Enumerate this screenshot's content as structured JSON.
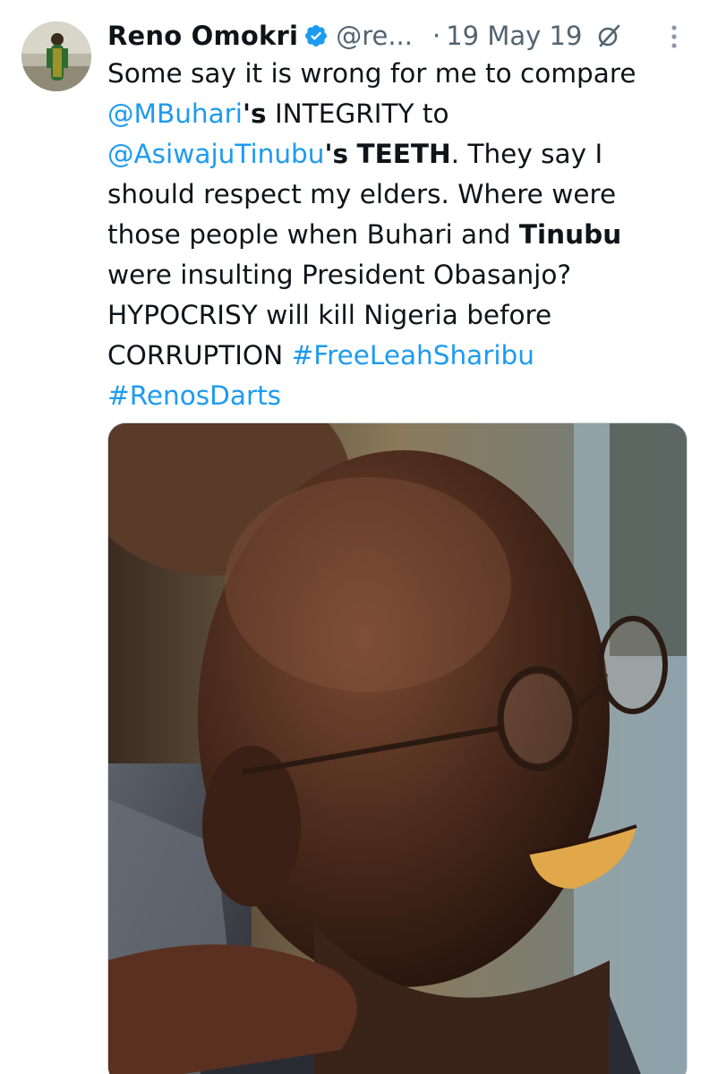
{
  "tweet": {
    "display_name": "Reno Omokri",
    "handle": "@re...",
    "dot": "·",
    "date": "19 May 19",
    "body": {
      "t1": "Some say it is wrong for me to compare ",
      "mention1": "@MBuhari",
      "t2": "'s",
      "t3": " INTEGRITY to ",
      "mention2": "@AsiwajuTinubu",
      "t4": "'s",
      "t5": "TEETH",
      "t6": ". They say I should respect my elders. Where were those people when Buhari and ",
      "t7": "Tinubu",
      "t8": " were insulting President Obasanjo? HYPOCRISY will kill Nigeria before CORRUPTION ",
      "hashtag1": "#FreeLeahSharibu",
      "hashtag2": "#RenosDarts"
    }
  },
  "icons": {
    "verified": "verified-badge-icon",
    "grok": "grok-icon",
    "more": "more-options-icon"
  },
  "colors": {
    "link": "#1d9bf0",
    "text": "#0f1419",
    "muted": "#536471"
  }
}
